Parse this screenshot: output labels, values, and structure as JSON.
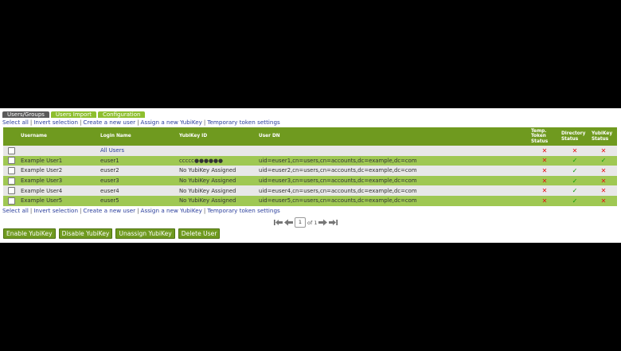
{
  "tabs": [
    "Users/Groups",
    "Users Import",
    "Configuration"
  ],
  "link_bar": [
    "Select all",
    "Invert selection",
    "Create a new user",
    "Assign a new YubiKey",
    "Temporary token settings"
  ],
  "columns": {
    "username": "Username",
    "login": "Login Name",
    "yubikey": "YubiKey ID",
    "dn": "User DN",
    "temp": "Temp. Token Status",
    "dir": "Directory Status",
    "yk": "YubiKey Status"
  },
  "rows": [
    {
      "username": "",
      "login": "All Users",
      "yubikey": "",
      "dn": "",
      "temp": "✕",
      "dir": "✕",
      "yk": "✕"
    },
    {
      "username": "Example User1",
      "login": "euser1",
      "yubikey": "ccccc●●●●●●",
      "dn": "uid=euser1,cn=users,cn=accounts,dc=example,dc=com",
      "temp": "✕",
      "dir": "✓",
      "yk": "✓"
    },
    {
      "username": "Example User2",
      "login": "euser2",
      "yubikey": "No YubiKey Assigned",
      "dn": "uid=euser2,cn=users,cn=accounts,dc=example,dc=com",
      "temp": "✕",
      "dir": "✓",
      "yk": "✕"
    },
    {
      "username": "Example User3",
      "login": "euser3",
      "yubikey": "No YubiKey Assigned",
      "dn": "uid=euser3,cn=users,cn=accounts,dc=example,dc=com",
      "temp": "✕",
      "dir": "✓",
      "yk": "✕"
    },
    {
      "username": "Example User4",
      "login": "euser4",
      "yubikey": "No YubiKey Assigned",
      "dn": "uid=euser4,cn=users,cn=accounts,dc=example,dc=com",
      "temp": "✕",
      "dir": "✓",
      "yk": "✕"
    },
    {
      "username": "Example User5",
      "login": "euser5",
      "yubikey": "No YubiKey Assigned",
      "dn": "uid=euser5,cn=users,cn=accounts,dc=example,dc=com",
      "temp": "✕",
      "dir": "✓",
      "yk": "✕"
    }
  ],
  "pager": {
    "page": "1",
    "of_label": "of 1"
  },
  "actions": [
    "Enable YubiKey",
    "Disable YubiKey",
    "Unassign YubiKey",
    "Delete User"
  ],
  "colors": {
    "accent": "#6f9a1f",
    "selected_row": "#9fc853",
    "active_tab": "#5a5a5a",
    "error": "#e31010",
    "success": "#0a9a0a",
    "link": "#2a3e9c"
  }
}
